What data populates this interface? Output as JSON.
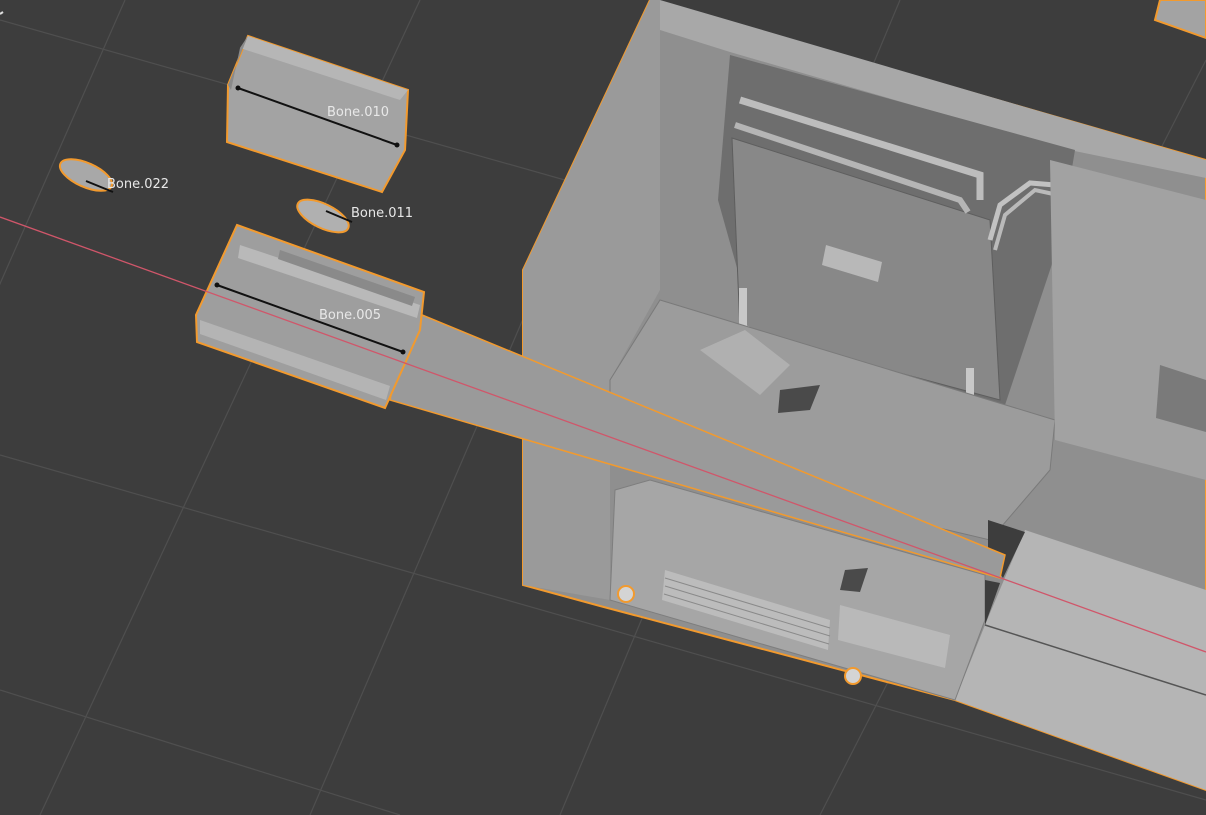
{
  "viewport": {
    "background": "#3d3d3d",
    "grid_color": "#4e4e4e",
    "x_axis_color": "#d0566a",
    "selection_outline_color": "#f29a2e"
  },
  "bones": [
    {
      "id": "bone_010",
      "label": "Bone.010"
    },
    {
      "id": "bone_022",
      "label": "Bone.022"
    },
    {
      "id": "bone_011",
      "label": "Bone.011"
    },
    {
      "id": "bone_005",
      "label": "Bone.005"
    }
  ]
}
